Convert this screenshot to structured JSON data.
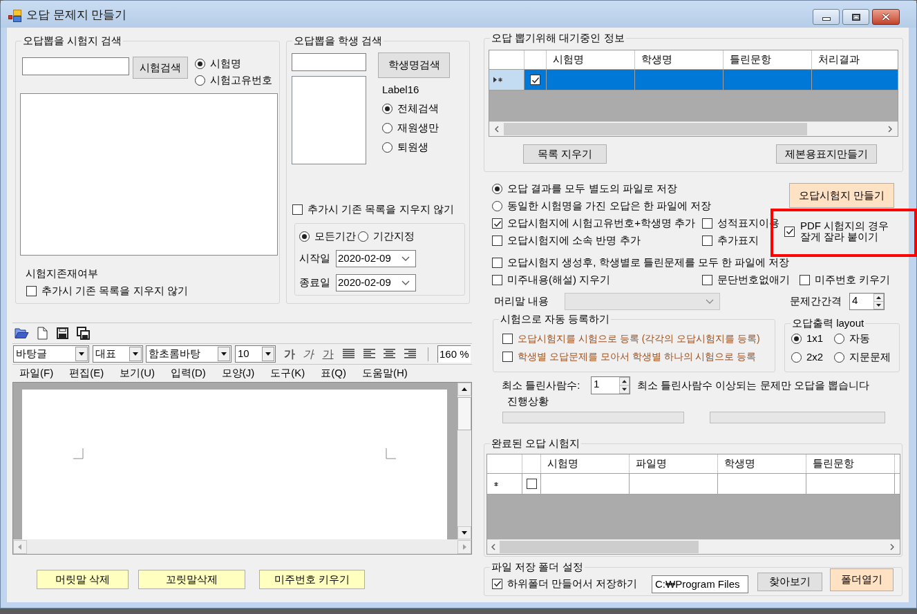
{
  "window": {
    "title": "오답 문제지 만들기"
  },
  "exam_search": {
    "title": "오답뽑을 시험지 검색",
    "search_button": "시험검색",
    "search_by": [
      {
        "label": "시험명",
        "selected": true
      },
      {
        "label": "시험고유번호",
        "selected": false
      }
    ],
    "existence_label": "시험지존재여부",
    "keep_list": {
      "label": "추가시 기존 목록을 지우지 않기",
      "checked": false
    }
  },
  "student_search": {
    "title": "오답뽑을 학생 검색",
    "search_button": "학생명검색",
    "filter_label": "Label16",
    "filters": [
      {
        "label": "전체검색",
        "selected": true
      },
      {
        "label": "재원생만",
        "selected": false
      },
      {
        "label": "퇴원생",
        "selected": false
      }
    ],
    "keep_list": {
      "label": "추가시 기존 목록을 지우지 않기",
      "checked": false
    },
    "period": [
      {
        "label": "모든기간",
        "selected": true
      },
      {
        "label": "기간지정",
        "selected": false
      }
    ],
    "dates": [
      {
        "label": "시작일",
        "value": "2020-02-09"
      },
      {
        "label": "종료일",
        "value": "2020-02-09"
      }
    ]
  },
  "editor": {
    "style_fields": [
      "바탕글",
      "대표",
      "함초롬바탕",
      "10"
    ],
    "format_buttons": [
      {
        "label": "가",
        "kind": "bold"
      },
      {
        "label": "가",
        "kind": "italic"
      },
      {
        "label": "가",
        "kind": "underline"
      }
    ],
    "zoom": "160 %",
    "menu": [
      "파일(F)",
      "편집(E)",
      "보기(U)",
      "입력(D)",
      "모양(J)",
      "도구(K)",
      "표(Q)",
      "도움말(H)"
    ],
    "buttons": [
      "머릿말 삭제",
      "꼬릿말삭제",
      "미주번호 키우기"
    ]
  },
  "pending": {
    "title": "오답 뽑기위해 대기중인 정보",
    "columns": [
      "시험명",
      "학생명",
      "틀린문항",
      "처리결과"
    ],
    "rows": [
      {
        "selected": true,
        "checked": true
      }
    ],
    "buttons": [
      "목록 지우기",
      "제본용표지만들기"
    ]
  },
  "save_modes": [
    {
      "label": "오답 결과를 모두 별도의 파일로 저장",
      "selected": true
    },
    {
      "label": "동일한 시험명을 가진 오답은 한 파일에 저장",
      "selected": false
    }
  ],
  "make_button": "오답시험지 만들기",
  "options": [
    {
      "label": "오답시험지에 시험고유번호+학생명 추가",
      "checked": true
    },
    {
      "label": "성적표지이용",
      "checked": false
    },
    {
      "label": "오답시험지에 소속 반명 추가",
      "checked": false
    },
    {
      "label": "추가표지",
      "checked": false
    },
    {
      "label": "PDF 시험지의 경우 잘게 잘라 붙이기",
      "checked": true
    },
    {
      "label": "오답시험지 생성후, 학생별로 틀린문제를 모두 한 파일에 저장",
      "checked": false
    },
    {
      "label": "미주내용(해설) 지우기",
      "checked": false
    },
    {
      "label": "문단번호없애기",
      "checked": false
    },
    {
      "label": "미주번호 키우기",
      "checked": false
    }
  ],
  "header_text": {
    "label": "머리말 내용",
    "disabled": true
  },
  "spacing": {
    "label": "문제간간격",
    "value": "4"
  },
  "auto_register": {
    "title": "시험으로 자동 등록하기",
    "items": [
      {
        "label": "오답시험지를 시험으로 등록 (각각의 오답시험지를 등록)",
        "checked": false
      },
      {
        "label": "학생별 오답문제를 모아서 학생별 하나의 시험으로 등록",
        "checked": false
      }
    ]
  },
  "output_layout": {
    "title": "오답출력 layout",
    "choices": [
      {
        "label": "1x1",
        "selected": true
      },
      {
        "label": "자동",
        "selected": false
      },
      {
        "label": "2x2",
        "selected": false
      },
      {
        "label": "지문문제",
        "selected": false
      }
    ]
  },
  "min_wrong": {
    "label": "최소 틀린사람수:",
    "value": "1",
    "note": "최소 틀린사람수 이상되는 문제만 오답을 뽑습니다"
  },
  "progress": {
    "label": "진행상황",
    "bars": [
      {
        "level": 0
      },
      {
        "level": 0
      }
    ]
  },
  "completed": {
    "title": "완료된 오답 시험지",
    "columns": [
      "시험명",
      "파일명",
      "학생명",
      "틀린문항"
    ],
    "rows": [
      {
        "selected": false,
        "checked": false
      }
    ]
  },
  "folder": {
    "title": "파일 저장 폴더 설정",
    "subfolder": {
      "label": "하위폴더 만들어서 저장하기",
      "checked": true
    },
    "path": "C:₩Program Files",
    "buttons": [
      {
        "label": "찾아보기",
        "kind": "normal"
      },
      {
        "label": "폴더열기",
        "kind": "accent"
      }
    ]
  }
}
